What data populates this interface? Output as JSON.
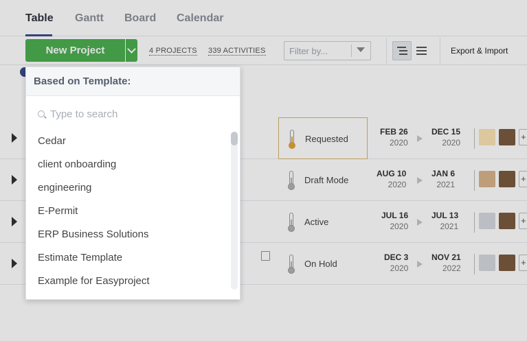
{
  "tabs": [
    {
      "label": "Table",
      "active": true
    },
    {
      "label": "Gantt",
      "active": false
    },
    {
      "label": "Board",
      "active": false
    },
    {
      "label": "Calendar",
      "active": false
    }
  ],
  "toolbar": {
    "new_project_label": "New Project",
    "projects_count": "4 PROJECTS",
    "activities_count": "339 ACTIVITIES",
    "filter_placeholder": "Filter by...",
    "export_label": "Export & Import"
  },
  "rows": [
    {
      "status": "Requested",
      "start_date": "FEB 26",
      "start_year": "2020",
      "end_date": "DEC 15",
      "end_year": "2020",
      "thermo_color": "#e0a43a"
    },
    {
      "status": "Draft Mode",
      "start_date": "AUG 10",
      "start_year": "2020",
      "end_date": "JAN 6",
      "end_year": "2021",
      "thermo_color": "#b0b4b9"
    },
    {
      "status": "Active",
      "start_date": "JUL 16",
      "start_year": "2020",
      "end_date": "JUL 13",
      "end_year": "2021",
      "thermo_color": "#b0b4b9"
    },
    {
      "status": "On Hold",
      "start_date": "DEC 3",
      "start_year": "2020",
      "end_date": "NOV 21",
      "end_year": "2022",
      "thermo_color": "#b0b4b9"
    }
  ],
  "dropdown": {
    "header": "Based on Template:",
    "search_placeholder": "Type to search",
    "items": [
      "Cedar",
      "client onboarding",
      "engineering",
      "E-Permit",
      "ERP Business Solutions",
      "Estimate Template",
      "Example for Easyproject"
    ]
  },
  "colors": {
    "accent": "#3b4c8f",
    "primary_button": "#4caf50",
    "highlight_border": "#d7b46a"
  }
}
